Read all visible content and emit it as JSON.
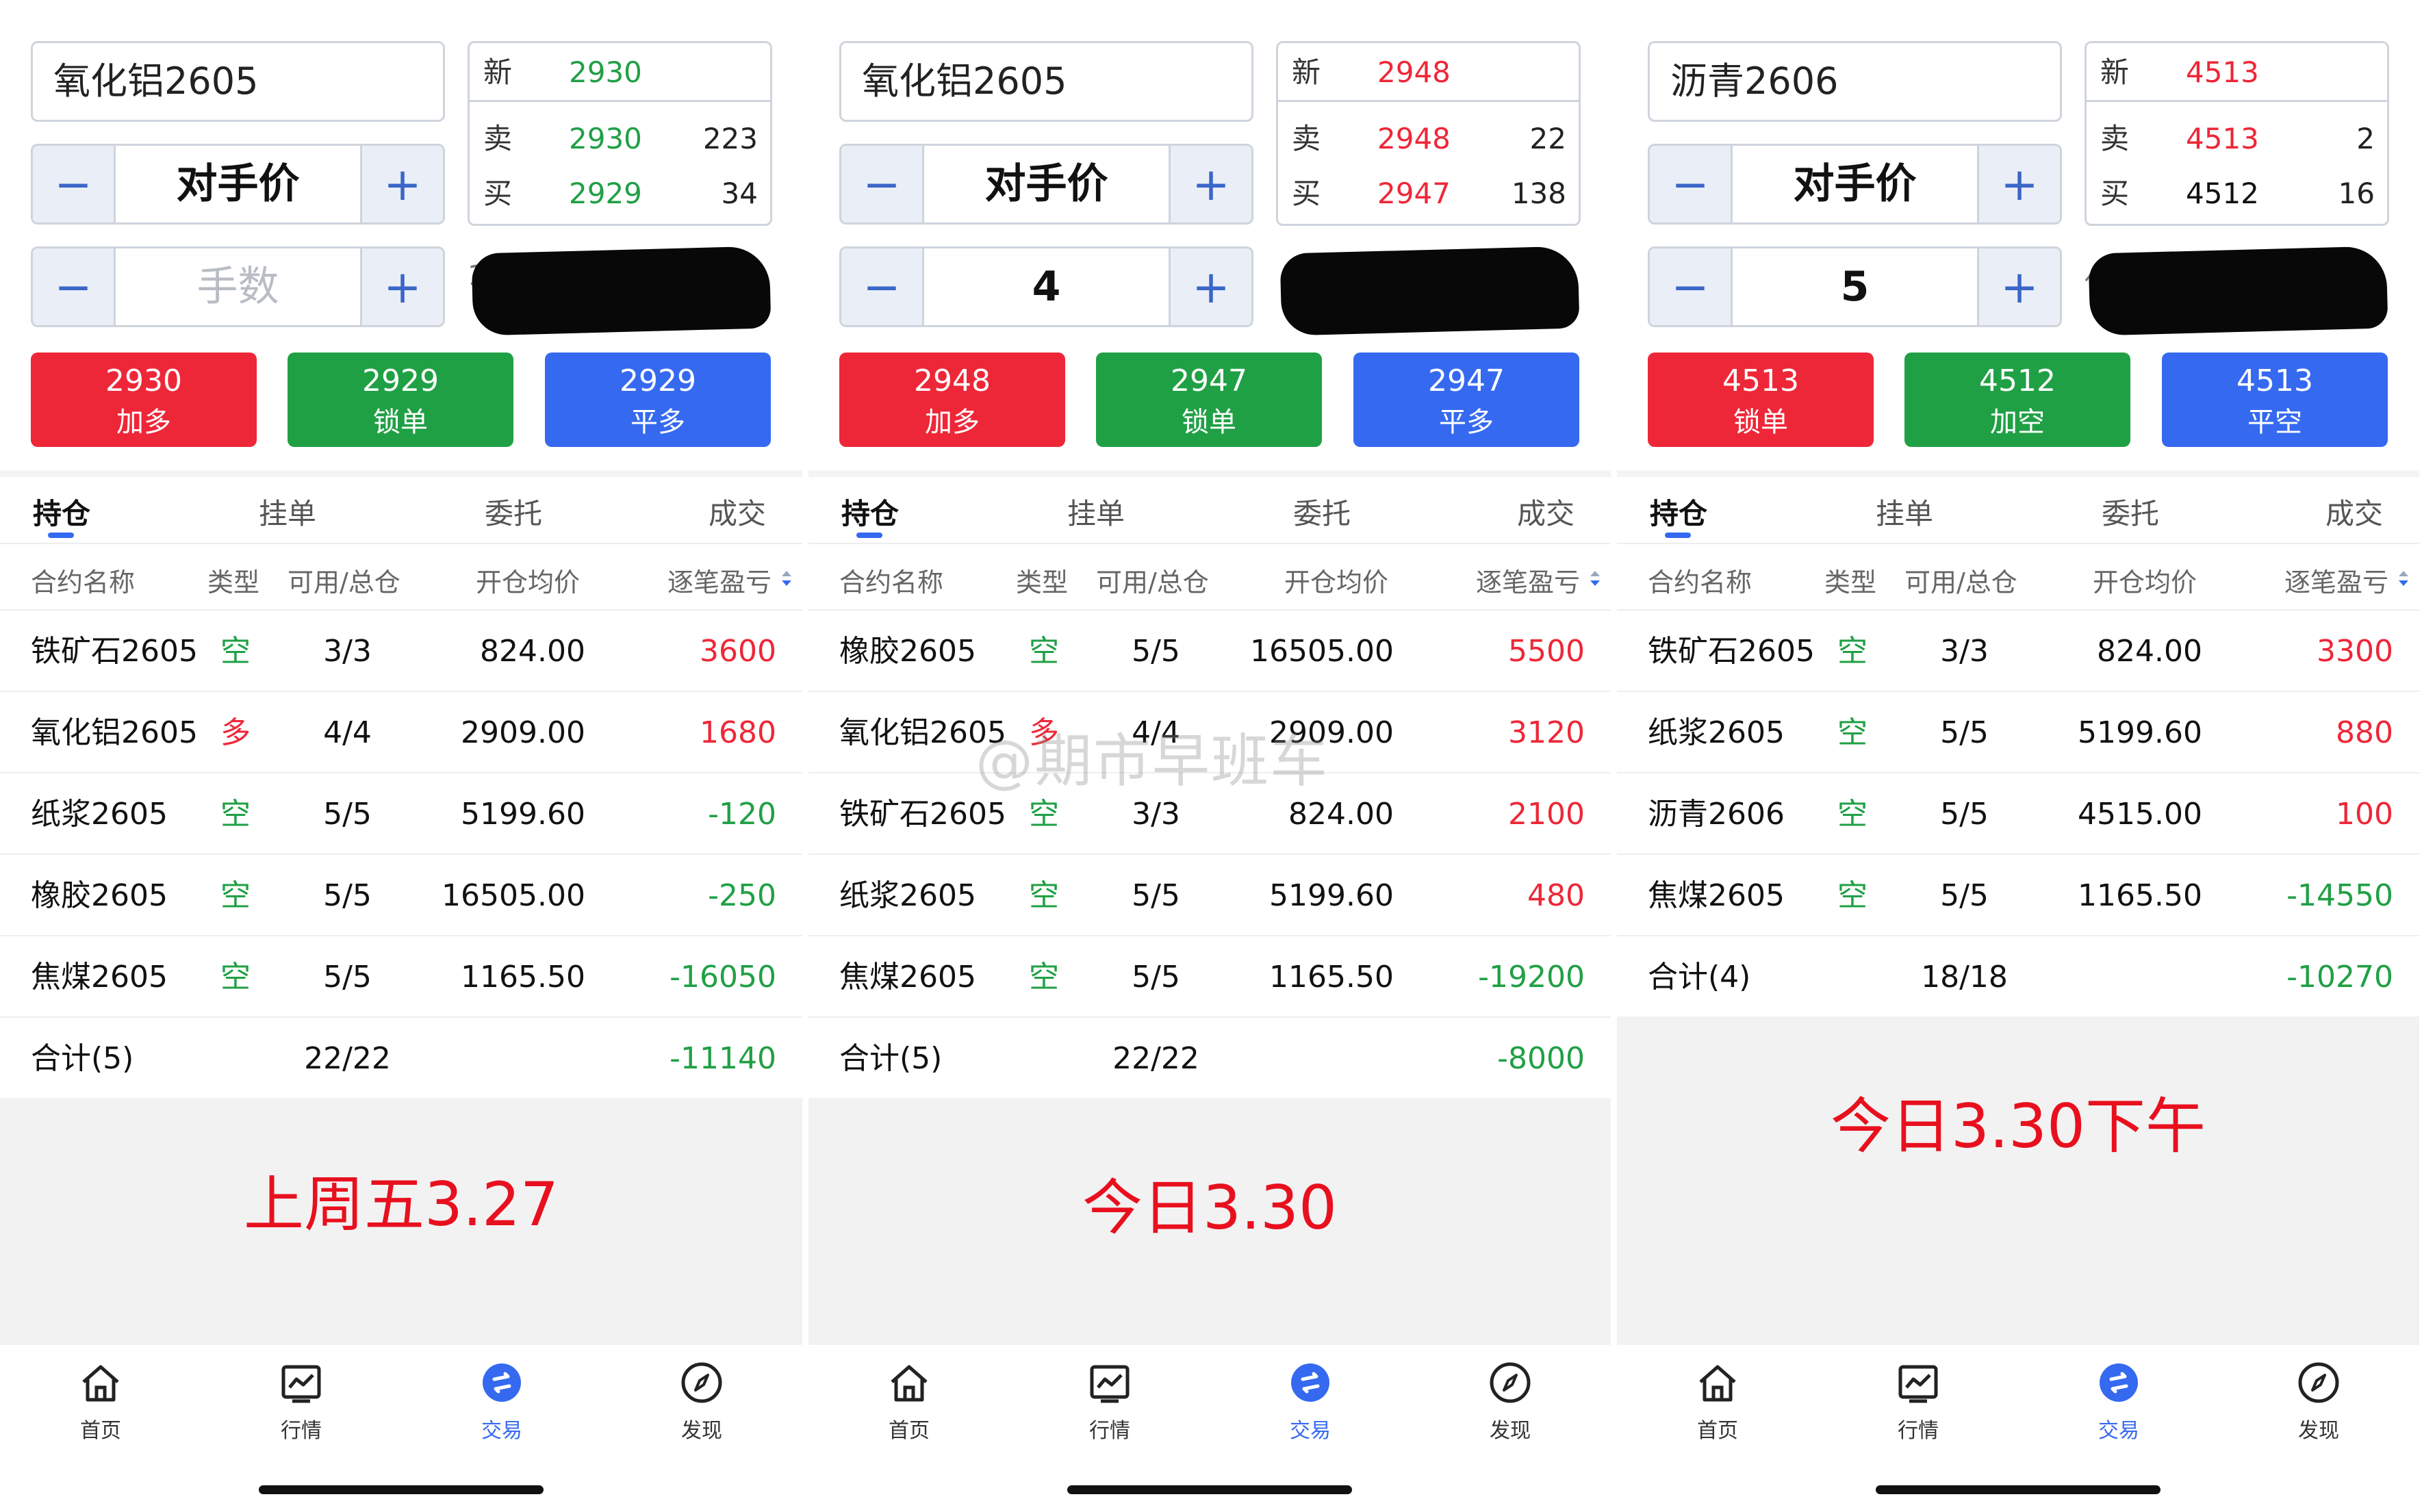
{
  "panels": [
    {
      "symbol": "氧化铝2605",
      "price_mode": "对手价",
      "quantity": "",
      "quantity_placeholder": "手数",
      "quote": {
        "new_label": "新",
        "new_price": "2930",
        "sell_label": "卖",
        "sell_price": "2930",
        "sell_vol": "223",
        "buy_label": "买",
        "buy_price": "2929",
        "buy_vol": "34",
        "price_color": "#20a045"
      },
      "redact_edge": "1",
      "actions": [
        {
          "price": "2930",
          "label": "加多"
        },
        {
          "price": "2929",
          "label": "锁单"
        },
        {
          "price": "2929",
          "label": "平多"
        }
      ],
      "tabs": [
        "持仓",
        "挂单",
        "委托",
        "成交"
      ],
      "columns": [
        "合约名称",
        "类型",
        "可用/总仓",
        "开仓均价",
        "逐笔盈亏"
      ],
      "rows": [
        {
          "name": "铁矿石2605",
          "type": "空",
          "avail": "3/3",
          "price": "824.00",
          "pnl": "3600",
          "sign": "pos",
          "type_color": "#20a045"
        },
        {
          "name": "氧化铝2605",
          "type": "多",
          "avail": "4/4",
          "price": "2909.00",
          "pnl": "1680",
          "sign": "pos",
          "type_color": "#ee2738"
        },
        {
          "name": "纸浆2605",
          "type": "空",
          "avail": "5/5",
          "price": "5199.60",
          "pnl": "-120",
          "sign": "neg",
          "type_color": "#20a045"
        },
        {
          "name": "橡胶2605",
          "type": "空",
          "avail": "5/5",
          "price": "16505.00",
          "pnl": "-250",
          "sign": "neg",
          "type_color": "#20a045"
        },
        {
          "name": "焦煤2605",
          "type": "空",
          "avail": "5/5",
          "price": "1165.50",
          "pnl": "-16050",
          "sign": "neg",
          "type_color": "#20a045"
        }
      ],
      "summary": {
        "label": "合计(5)",
        "avail": "22/22",
        "pnl": "-11140"
      },
      "caption": "上周五3.27",
      "nav": [
        "首页",
        "行情",
        "交易",
        "发现"
      ]
    },
    {
      "symbol": "氧化铝2605",
      "price_mode": "对手价",
      "quantity": "4",
      "quantity_placeholder": "",
      "quote": {
        "new_label": "新",
        "new_price": "2948",
        "sell_label": "卖",
        "sell_price": "2948",
        "sell_vol": "22",
        "buy_label": "买",
        "buy_price": "2947",
        "buy_vol": "138",
        "price_color": "#ee2738"
      },
      "redact_edge": "",
      "actions": [
        {
          "price": "2948",
          "label": "加多"
        },
        {
          "price": "2947",
          "label": "锁单"
        },
        {
          "price": "2947",
          "label": "平多"
        }
      ],
      "tabs": [
        "持仓",
        "挂单",
        "委托",
        "成交"
      ],
      "columns": [
        "合约名称",
        "类型",
        "可用/总仓",
        "开仓均价",
        "逐笔盈亏"
      ],
      "rows": [
        {
          "name": "橡胶2605",
          "type": "空",
          "avail": "5/5",
          "price": "16505.00",
          "pnl": "5500",
          "sign": "pos",
          "type_color": "#20a045"
        },
        {
          "name": "氧化铝2605",
          "type": "多",
          "avail": "4/4",
          "price": "2909.00",
          "pnl": "3120",
          "sign": "pos",
          "type_color": "#ee2738"
        },
        {
          "name": "铁矿石2605",
          "type": "空",
          "avail": "3/3",
          "price": "824.00",
          "pnl": "2100",
          "sign": "pos",
          "type_color": "#20a045"
        },
        {
          "name": "纸浆2605",
          "type": "空",
          "avail": "5/5",
          "price": "5199.60",
          "pnl": "480",
          "sign": "pos",
          "type_color": "#20a045"
        },
        {
          "name": "焦煤2605",
          "type": "空",
          "avail": "5/5",
          "price": "1165.50",
          "pnl": "-19200",
          "sign": "neg",
          "type_color": "#20a045"
        }
      ],
      "summary": {
        "label": "合计(5)",
        "avail": "22/22",
        "pnl": "-8000"
      },
      "caption": "今日3.30",
      "nav": [
        "首页",
        "行情",
        "交易",
        "发现"
      ]
    },
    {
      "symbol": "沥青2606",
      "price_mode": "对手价",
      "quantity": "5",
      "quantity_placeholder": "",
      "quote": {
        "new_label": "新",
        "new_price": "4513",
        "sell_label": "卖",
        "sell_price": "4513",
        "sell_vol": "2",
        "buy_label": "买",
        "buy_price": "4512",
        "buy_vol": "16",
        "price_color": "#ee2738",
        "buy_price_color": "#111111"
      },
      "redact_edge": "保",
      "actions": [
        {
          "price": "4513",
          "label": "锁单"
        },
        {
          "price": "4512",
          "label": "加空"
        },
        {
          "price": "4513",
          "label": "平空"
        }
      ],
      "tabs": [
        "持仓",
        "挂单",
        "委托",
        "成交"
      ],
      "columns": [
        "合约名称",
        "类型",
        "可用/总仓",
        "开仓均价",
        "逐笔盈亏"
      ],
      "rows": [
        {
          "name": "铁矿石2605",
          "type": "空",
          "avail": "3/3",
          "price": "824.00",
          "pnl": "3300",
          "sign": "pos",
          "type_color": "#20a045"
        },
        {
          "name": "纸浆2605",
          "type": "空",
          "avail": "5/5",
          "price": "5199.60",
          "pnl": "880",
          "sign": "pos",
          "type_color": "#20a045"
        },
        {
          "name": "沥青2606",
          "type": "空",
          "avail": "5/5",
          "price": "4515.00",
          "pnl": "100",
          "sign": "pos",
          "type_color": "#20a045"
        },
        {
          "name": "焦煤2605",
          "type": "空",
          "avail": "5/5",
          "price": "1165.50",
          "pnl": "-14550",
          "sign": "neg",
          "type_color": "#20a045"
        }
      ],
      "summary": {
        "label": "合计(4)",
        "avail": "18/18",
        "pnl": "-10270"
      },
      "caption": "今日3.30下午",
      "nav": [
        "首页",
        "行情",
        "交易",
        "发现"
      ]
    }
  ],
  "watermark": "@期市早班车",
  "icons": {
    "minus": "minus-icon",
    "plus": "plus-icon",
    "sort": "sort-icon",
    "home": "home-icon",
    "market": "chart-icon",
    "trade": "trade-icon",
    "discover": "compass-icon"
  }
}
